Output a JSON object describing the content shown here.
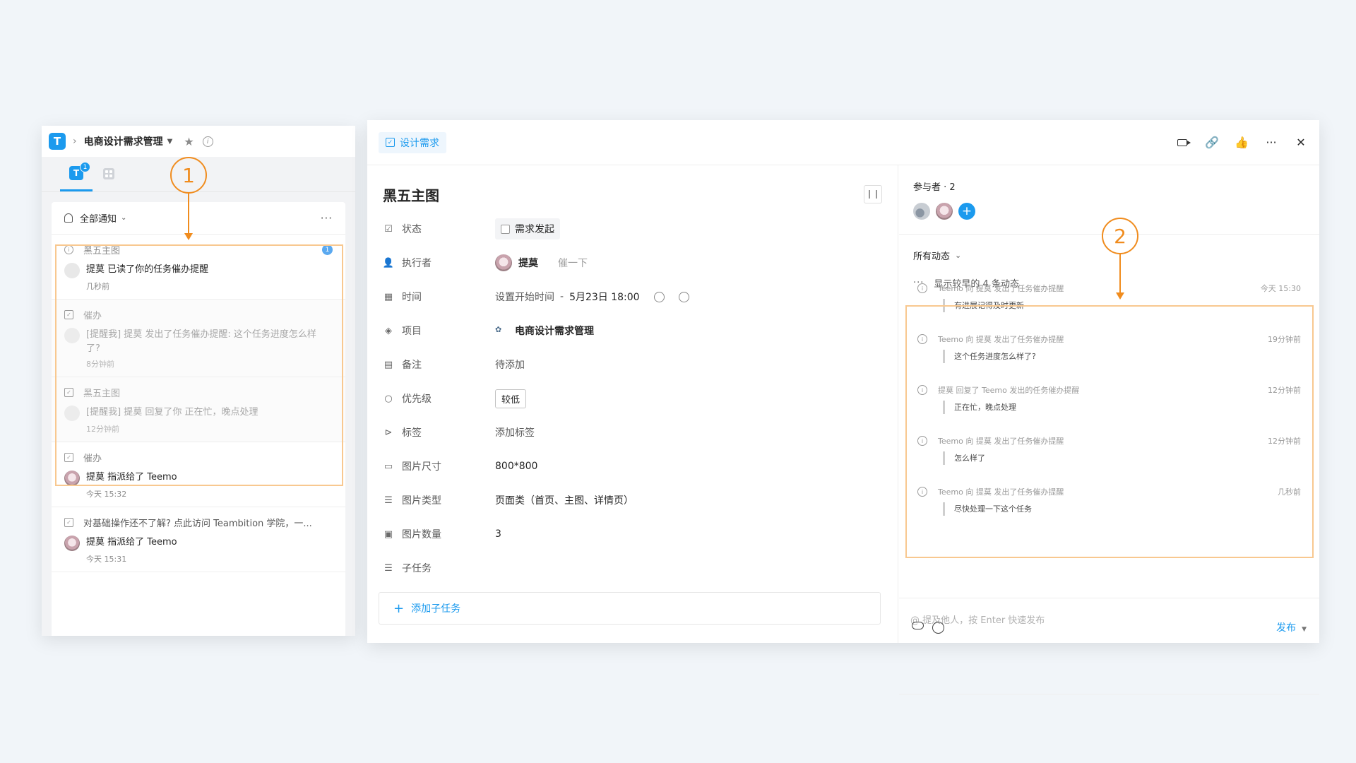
{
  "left": {
    "project_name": "电商设计需求管理",
    "logo_letter": "T",
    "tab_badge": "1",
    "notif_filter": "全部通知",
    "notifications": [
      {
        "category": "黑五主图",
        "message": "提莫 已读了你的任务催办提醒",
        "time": "几秒前",
        "badge": "1",
        "icon": "info-icon"
      },
      {
        "category": "催办",
        "message": "[提醒我] 提莫 发出了任务催办提醒: 这个任务进度怎么样了?",
        "time": "8分钟前",
        "icon": "check-icon"
      },
      {
        "category": "黑五主图",
        "message": "[提醒我] 提莫 回复了你 正在忙，晚点处理",
        "time": "12分钟前",
        "icon": "check-icon"
      },
      {
        "category": "催办",
        "message": "提莫 指派给了 Teemo",
        "time": "今天 15:32",
        "icon": "check-icon"
      },
      {
        "category": "对基础操作还不了解? 点此访问 Teambition 学院，一...",
        "message": "提莫 指派给了 Teemo",
        "time": "今天 15:31",
        "icon": "check-icon"
      }
    ]
  },
  "task": {
    "type_label": "设计需求",
    "title": "黑五主图",
    "fields": {
      "status_label": "状态",
      "status_value": "需求发起",
      "assignee_label": "执行者",
      "assignee_value": "提莫",
      "nudge": "催一下",
      "time_label": "时间",
      "time_start": "设置开始时间",
      "time_dash": "-",
      "time_end": "5月23日 18:00",
      "project_label": "项目",
      "project_value": "电商设计需求管理",
      "note_label": "备注",
      "note_value": "待添加",
      "priority_label": "优先级",
      "priority_value": "较低",
      "tag_label": "标签",
      "tag_value": "添加标签",
      "size_label": "图片尺寸",
      "size_value": "800*800",
      "imgtype_label": "图片类型",
      "imgtype_value": "页面类（首页、主图、详情页）",
      "count_label": "图片数量",
      "count_value": "3",
      "subtask_label": "子任务"
    },
    "add_subtask": "添加子任务"
  },
  "side": {
    "participants_title": "参与者 · 2",
    "activity_filter": "所有动态",
    "show_earlier": "显示较早的 4 条动态",
    "activities": [
      {
        "text": "Teemo 向 提莫 发出了任务催办提醒",
        "time": "今天 15:30",
        "quote": "有进展记得及时更新"
      },
      {
        "text": "Teemo 向 提莫 发出了任务催办提醒",
        "time": "19分钟前",
        "quote": "这个任务进度怎么样了?"
      },
      {
        "text": "提莫 回复了 Teemo 发出的任务催办提醒",
        "time": "12分钟前",
        "quote": "正在忙，晚点处理"
      },
      {
        "text": "Teemo 向 提莫 发出了任务催办提醒",
        "time": "12分钟前",
        "quote": "怎么样了"
      },
      {
        "text": "Teemo 向 提莫 发出了任务催办提醒",
        "time": "几秒前",
        "quote": "尽快处理一下这个任务"
      }
    ],
    "comment_placeholder": "@ 提及他人，按 Enter 快速发布",
    "publish": "发布"
  },
  "annotations": {
    "one": "1",
    "two": "2"
  },
  "colors": {
    "accent": "#1b9aee",
    "annotation": "#f08c1e",
    "annotation_box": "#f8c890"
  }
}
